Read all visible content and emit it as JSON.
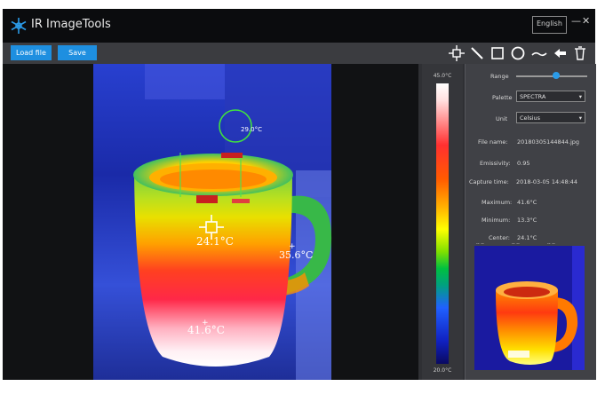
{
  "app": {
    "title": "IR ImageTools",
    "language": "English"
  },
  "window_controls": {
    "minimize": "—",
    "close": "✕"
  },
  "toolbar": {
    "buttons": [
      {
        "label": "Load file"
      },
      {
        "label": "Save"
      }
    ],
    "tools": [
      "crosshair-icon",
      "line-icon",
      "rectangle-icon",
      "circle-icon",
      "curve-icon",
      "undo-arrow-icon",
      "trash-icon"
    ]
  },
  "scale": {
    "max_label": "45.0°C",
    "min_label": "20.0°C"
  },
  "panel": {
    "slider_label": "Range",
    "slider_value": 0.63,
    "palette_label": "Palette",
    "palette_value": "SPECTRA",
    "unit_label": "Unit",
    "unit_value": "Celsius",
    "info_rows": [
      {
        "label": "File name:",
        "value": "20180305144844.jpg"
      },
      {
        "label": "Emissivity:",
        "value": "0.95"
      },
      {
        "label": "Capture time:",
        "value": "2018-03-05 14:48:44"
      },
      {
        "label": "Maximum:",
        "value": "41.6°C"
      },
      {
        "label": "Minimum:",
        "value": "13.3°C"
      },
      {
        "label": "Center:",
        "value": "24.1°C"
      }
    ],
    "thumb_labels": [
      "-- --",
      "-- --",
      "-- --"
    ]
  },
  "measurements": {
    "center_point": "24.1°C",
    "right_point": "35.6°C",
    "bottom_point": "41.6°C",
    "circle_label": "29.0°C"
  }
}
